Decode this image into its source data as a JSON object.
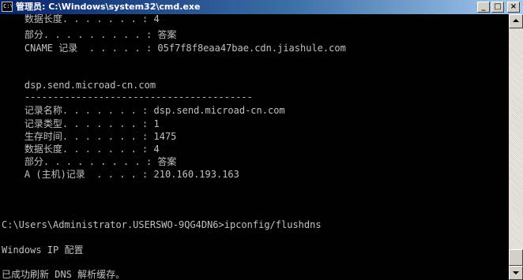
{
  "window": {
    "title": "管理员: C:\\Windows\\system32\\cmd.exe",
    "icon_text": "C:\\",
    "buttons": {
      "minimize": "_",
      "maximize": "□",
      "close": "×"
    }
  },
  "colors": {
    "console_bg": "#000000",
    "console_fg": "#c0c0c0",
    "titlebar_start": "#0a246a",
    "titlebar_end": "#a6caf0"
  },
  "console": {
    "lines": [
      "    数据长度. . . . . . . : 4",
      "    部分. . . . . . . . . : 答案",
      "    CNAME 记录  . . . . . : 05f7f8f8eaa47bae.cdn.jiashule.com",
      "",
      "",
      "    dsp.send.microad-cn.com",
      "    ----------------------------------------",
      "    记录名称. . . . . . . : dsp.send.microad-cn.com",
      "    记录类型. . . . . . . : 1",
      "    生存时间. . . . . . . : 1475",
      "    数据长度. . . . . . . : 4",
      "    部分. . . . . . . . . : 答案",
      "    A (主机)记录  . . . . : 210.160.193.163",
      "",
      "",
      "",
      "C:\\Users\\Administrator.USERSWO-9QG4DN6>ipconfig/flushdns",
      "",
      "Windows IP 配置",
      "",
      "已成功刷新 DNS 解析缓存。"
    ]
  },
  "scrollbar": {
    "position_fraction": 0.97
  }
}
